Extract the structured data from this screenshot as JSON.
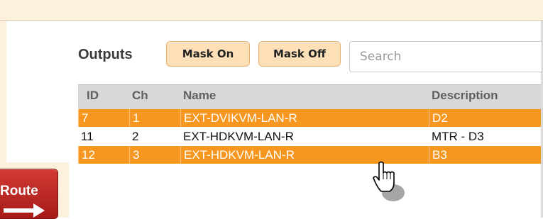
{
  "outputs": {
    "title": "Outputs",
    "mask_on_label": "Mask On",
    "mask_off_label": "Mask Off",
    "search_placeholder": "Search",
    "columns": [
      "ID",
      "Ch",
      "Name",
      "Description"
    ],
    "rows": [
      {
        "id": "7",
        "ch": "1",
        "name": "EXT-DVIKVM-LAN-R",
        "description": "D2",
        "selected": true
      },
      {
        "id": "11",
        "ch": "2",
        "name": "EXT-HDKVM-LAN-R",
        "description": "MTR - D3",
        "selected": false
      },
      {
        "id": "12",
        "ch": "3",
        "name": "EXT-HDKVM-LAN-R",
        "description": "B3",
        "selected": true
      }
    ]
  },
  "route_button": {
    "label": "Route"
  },
  "colors": {
    "selected_row": "#f7971f",
    "button_bg": "#fde0b8",
    "route_red": "#c0272d",
    "panel_bg": "#fdf0dc"
  },
  "icons": {
    "route_arrow": "arrow-right-icon",
    "cursor": "hand-pointer-icon"
  }
}
